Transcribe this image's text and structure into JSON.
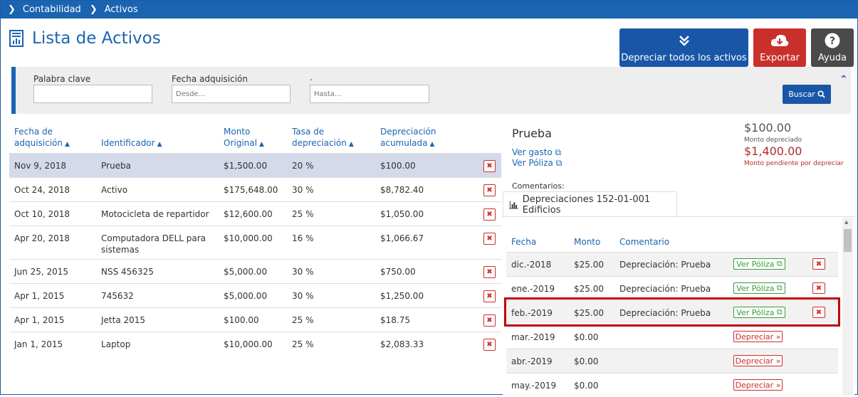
{
  "breadcrumb": {
    "items": [
      "Contabilidad",
      "Activos"
    ]
  },
  "page": {
    "title": "Lista de Activos"
  },
  "actions": {
    "depreciate_all": "Depreciar todos los activos",
    "export": "Exportar",
    "help": "Ayuda",
    "help_icon": "question-circle-icon"
  },
  "filters": {
    "keyword_label": "Palabra clave",
    "keyword_value": "",
    "date_label": "Fecha adquisición",
    "from_placeholder": "Desde...",
    "to_label": ".",
    "to_placeholder": "Hasta...",
    "search_label": "Buscar"
  },
  "table": {
    "headers": {
      "date_l1": "Fecha de",
      "date_l2": "adquisición",
      "identifier": "Identificador",
      "amount_l1": "Monto",
      "amount_l2": "Original",
      "rate_l1": "Tasa de",
      "rate_l2": "depreciación",
      "accum_l1": "Depreciación",
      "accum_l2": "acumulada"
    },
    "rows": [
      {
        "date": "Nov 9, 2018",
        "id": "Prueba",
        "amount": "$1,500.00",
        "rate": "20 %",
        "accum": "$100.00"
      },
      {
        "date": "Oct 24, 2018",
        "id": "Activo",
        "amount": "$175,648.00",
        "rate": "30 %",
        "accum": "$8,782.40"
      },
      {
        "date": "Oct 10, 2018",
        "id": "Motocicleta de repartidor",
        "amount": "$12,600.00",
        "rate": "25 %",
        "accum": "$1,050.00"
      },
      {
        "date": "Apr 20, 2018",
        "id": "Computadora DELL para sistemas",
        "amount": "$10,000.00",
        "rate": "16 %",
        "accum": "$1,066.67"
      },
      {
        "date": "Jun 25, 2015",
        "id": "NSS 456325",
        "amount": "$5,000.00",
        "rate": "30 %",
        "accum": "$750.00"
      },
      {
        "date": "Apr 1, 2015",
        "id": "745632",
        "amount": "$5,000.00",
        "rate": "30 %",
        "accum": "$1,250.00"
      },
      {
        "date": "Apr 1, 2015",
        "id": "Jetta 2015",
        "amount": "$100.00",
        "rate": "25 %",
        "accum": "$18.75"
      },
      {
        "date": "Jan 1, 2015",
        "id": "Laptop",
        "amount": "$10,000.00",
        "rate": "25 %",
        "accum": "$2,083.33"
      }
    ],
    "delete_glyph": "✖"
  },
  "detail": {
    "name": "Prueba",
    "view_expense": "Ver gasto",
    "view_policy": "Ver Póliza",
    "depreciated_amount": "$100.00",
    "depreciated_label": "Monto depreciado",
    "pending_amount": "$1,400.00",
    "pending_label": "Monto pendiente por depreciar",
    "comments_label": "Comentarios:",
    "tab_label": "Depreciaciones 152-01-001 Edificios",
    "headers": {
      "date": "Fecha",
      "amount": "Monto",
      "comment": "Comentario"
    },
    "view_policy_btn": "Ver Póliza",
    "depreciate_btn": "Depreciar",
    "rows": [
      {
        "date": "dic.-2018",
        "amount": "$25.00",
        "comment": "Depreciación: Prueba",
        "status": "done"
      },
      {
        "date": "ene.-2019",
        "amount": "$25.00",
        "comment": "Depreciación: Prueba",
        "status": "done"
      },
      {
        "date": "feb.-2019",
        "amount": "$25.00",
        "comment": "Depreciación: Prueba",
        "status": "done"
      },
      {
        "date": "mar.-2019",
        "amount": "$0.00",
        "comment": "",
        "status": "pending"
      },
      {
        "date": "abr.-2019",
        "amount": "$0.00",
        "comment": "",
        "status": "pending"
      },
      {
        "date": "may.-2019",
        "amount": "$0.00",
        "comment": "",
        "status": "pending"
      }
    ]
  },
  "colors": {
    "accent": "#1a64b1",
    "danger": "#c9302c",
    "success": "#3a9a3a",
    "highlight": "#c00000"
  }
}
